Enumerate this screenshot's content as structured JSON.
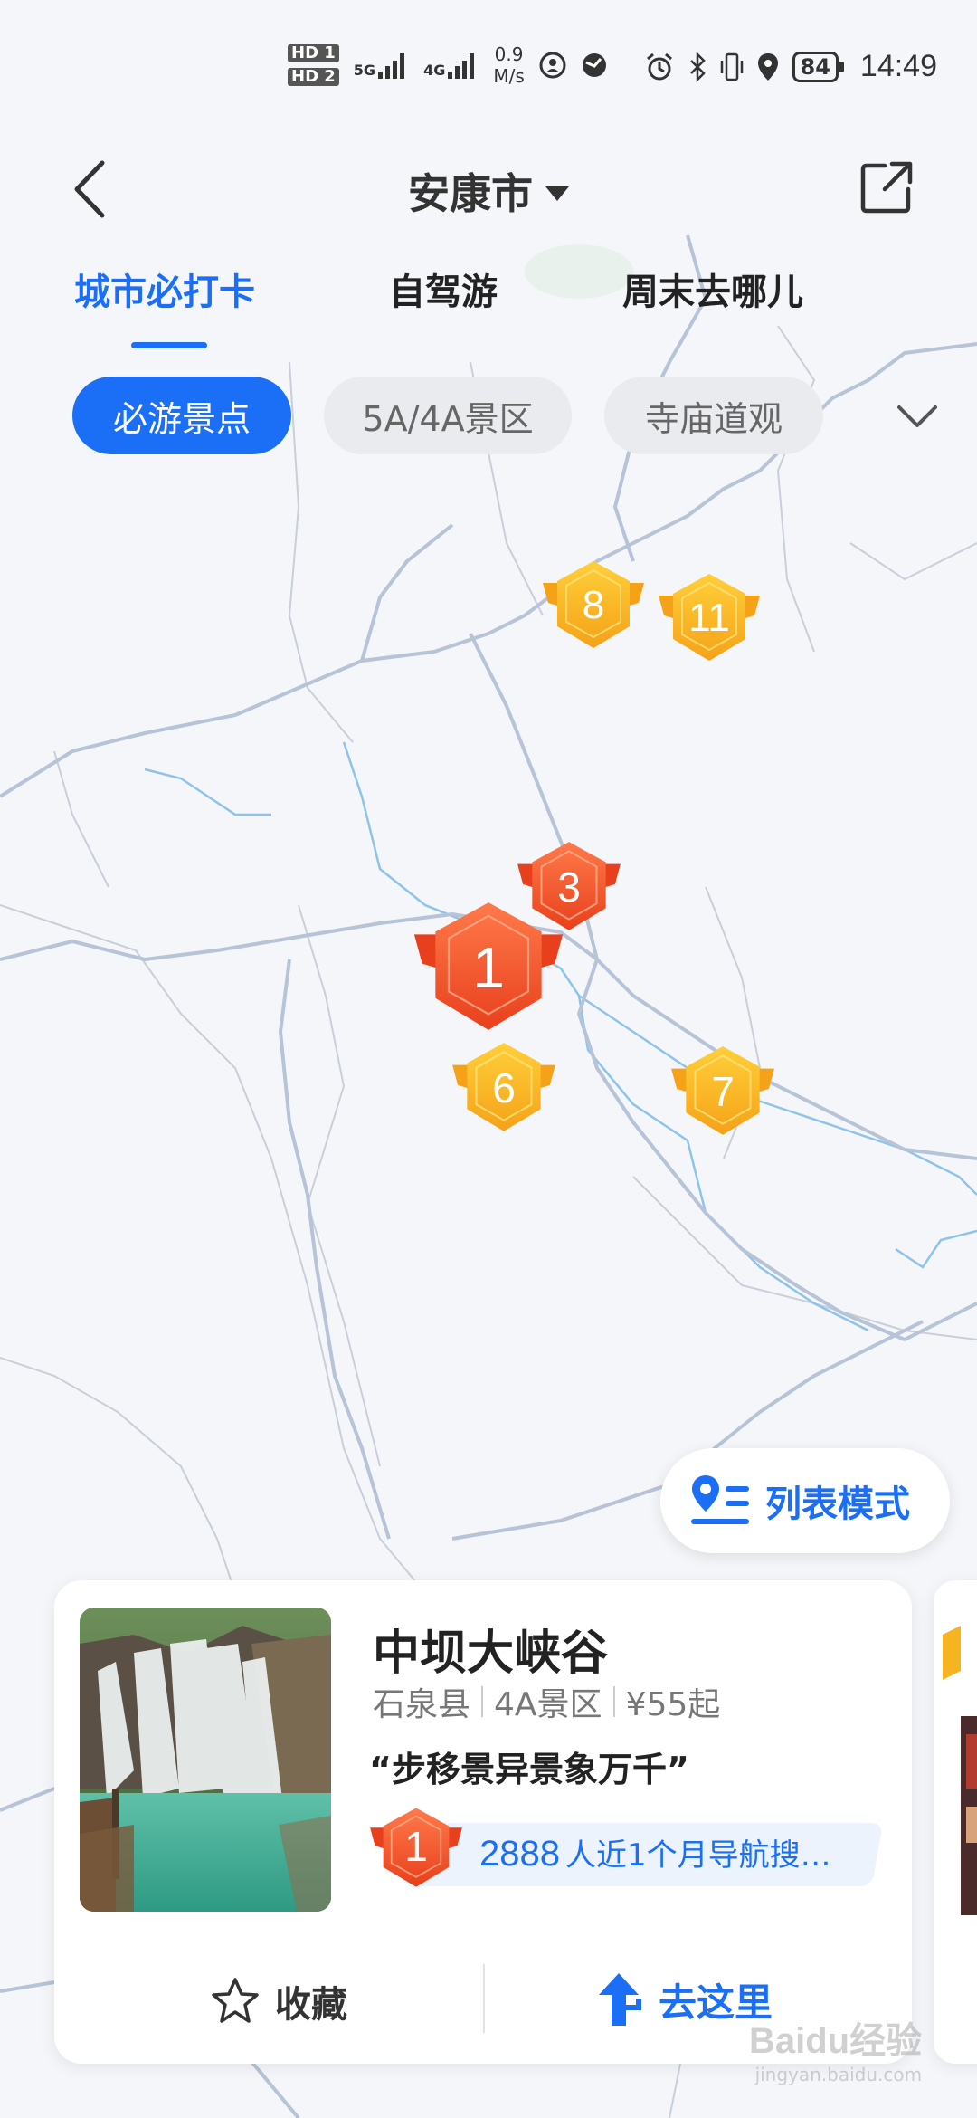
{
  "status_bar": {
    "hd1": "HD 1",
    "hd2": "HD 2",
    "net1": "5G",
    "net2": "4G",
    "speed_value": "0.9",
    "speed_unit": "M/s",
    "battery": "84",
    "time": "14:49"
  },
  "header": {
    "title": "安康市"
  },
  "tabs": [
    {
      "label": "城市必打卡",
      "active": true
    },
    {
      "label": "自驾游",
      "active": false
    },
    {
      "label": "周末去哪儿",
      "active": false
    }
  ],
  "chips": [
    {
      "label": "必游景点",
      "active": true
    },
    {
      "label": "5A/4A景区",
      "active": false
    },
    {
      "label": "寺庙道观",
      "active": false
    }
  ],
  "markers": [
    {
      "rank": "1",
      "tier": "top"
    },
    {
      "rank": "3",
      "tier": "top"
    },
    {
      "rank": "6",
      "tier": "normal"
    },
    {
      "rank": "7",
      "tier": "normal"
    },
    {
      "rank": "8",
      "tier": "normal"
    },
    {
      "rank": "11",
      "tier": "normal"
    }
  ],
  "list_mode": {
    "label": "列表模式"
  },
  "card": {
    "name": "中坝大峡谷",
    "county": "石泉县",
    "level": "4A景区",
    "price": "¥55起",
    "quote": "“步移景异景象万千”",
    "rank": "1",
    "search_count": "2888",
    "search_text": "人近1个月导航搜…",
    "fav_label": "收藏",
    "go_label": "去这里"
  },
  "watermark": {
    "text": "Baidu经验",
    "url_text": "jingyan.baidu.com"
  },
  "colors": {
    "accent": "#1a6ff6",
    "marker_top": "#f0502a",
    "marker_normal": "#f7b422",
    "map_bg": "#f4f6fa",
    "road": "#b7c3d6",
    "river": "#8ec3ea"
  }
}
